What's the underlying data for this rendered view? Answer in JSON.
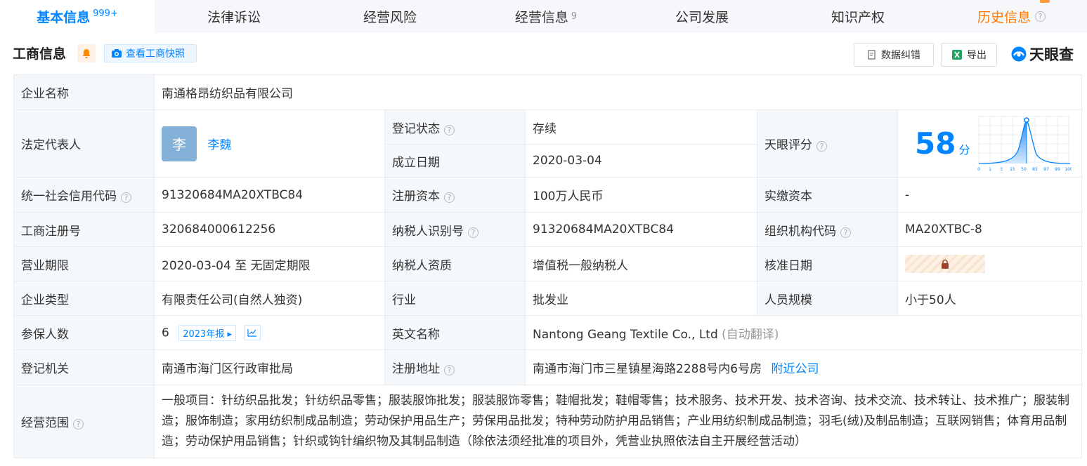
{
  "tabs": [
    {
      "label": "基本信息",
      "badge": "999+"
    },
    {
      "label": "法律诉讼"
    },
    {
      "label": "经营风险"
    },
    {
      "label": "经营信息",
      "count": "9"
    },
    {
      "label": "公司发展"
    },
    {
      "label": "知识产权"
    },
    {
      "label": "历史信息"
    }
  ],
  "header": {
    "title": "工商信息",
    "snapshot_btn": "查看工商快照",
    "correct_btn": "数据纠错",
    "export_btn": "导出",
    "brand": "天眼查"
  },
  "info": {
    "company_name_label": "企业名称",
    "company_name": "南通格昂纺织品有限公司",
    "legal_rep_label": "法定代表人",
    "legal_rep_avatar": "李",
    "legal_rep": "李魏",
    "reg_status_label": "登记状态",
    "reg_status": "存续",
    "found_date_label": "成立日期",
    "found_date": "2020-03-04",
    "score_label": "天眼评分",
    "score": "58",
    "score_unit": "分",
    "score_ticks": [
      "0",
      "1",
      "3",
      "15",
      "50",
      "85",
      "97",
      "99",
      "100"
    ],
    "credit_code_label": "统一社会信用代码",
    "credit_code": "91320684MA20XTBC84",
    "reg_capital_label": "注册资本",
    "reg_capital": "100万人民币",
    "paid_capital_label": "实缴资本",
    "paid_capital": "-",
    "reg_no_label": "工商注册号",
    "reg_no": "320684000612256",
    "taxpayer_id_label": "纳税人识别号",
    "taxpayer_id": "91320684MA20XTBC84",
    "org_code_label": "组织机构代码",
    "org_code": "MA20XTBC-8",
    "term_label": "营业期限",
    "term": "2020-03-04 至 无固定期限",
    "tax_qual_label": "纳税人资质",
    "tax_qual": "增值税一般纳税人",
    "approve_date_label": "核准日期",
    "type_label": "企业类型",
    "type": "有限责任公司(自然人独资)",
    "industry_label": "行业",
    "industry": "批发业",
    "staff_label": "人员规模",
    "staff": "小于50人",
    "insured_label": "参保人数",
    "insured": "6",
    "insured_year": "2023年报",
    "en_name_label": "英文名称",
    "en_name": "Nantong Geang Textile Co., Ltd",
    "en_name_note": "(自动翻译)",
    "authority_label": "登记机关",
    "authority": "南通市海门区行政审批局",
    "address_label": "注册地址",
    "address": "南通市海门市三星镇星海路2288号内6号房",
    "nearby": "附近公司",
    "scope_label": "经营范围",
    "scope": "一般项目：针纺织品批发；针纺织品零售；服装服饰批发；服装服饰零售；鞋帽批发；鞋帽零售；技术服务、技术开发、技术咨询、技术交流、技术转让、技术推广；服装制造；服饰制造；家用纺织制成品制造；劳动保护用品生产；劳保用品批发；特种劳动防护用品销售；产业用纺织制成品制造；羽毛(绒)及制品制造；互联网销售；体育用品制造；劳动保护用品销售；针织或钩针编织物及其制品制造（除依法须经批准的项目外，凭营业执照依法自主开展经营活动）"
  },
  "colors": {
    "accent": "#0084ff",
    "status_green": "#13a85b",
    "history_orange": "#ff7a00"
  }
}
